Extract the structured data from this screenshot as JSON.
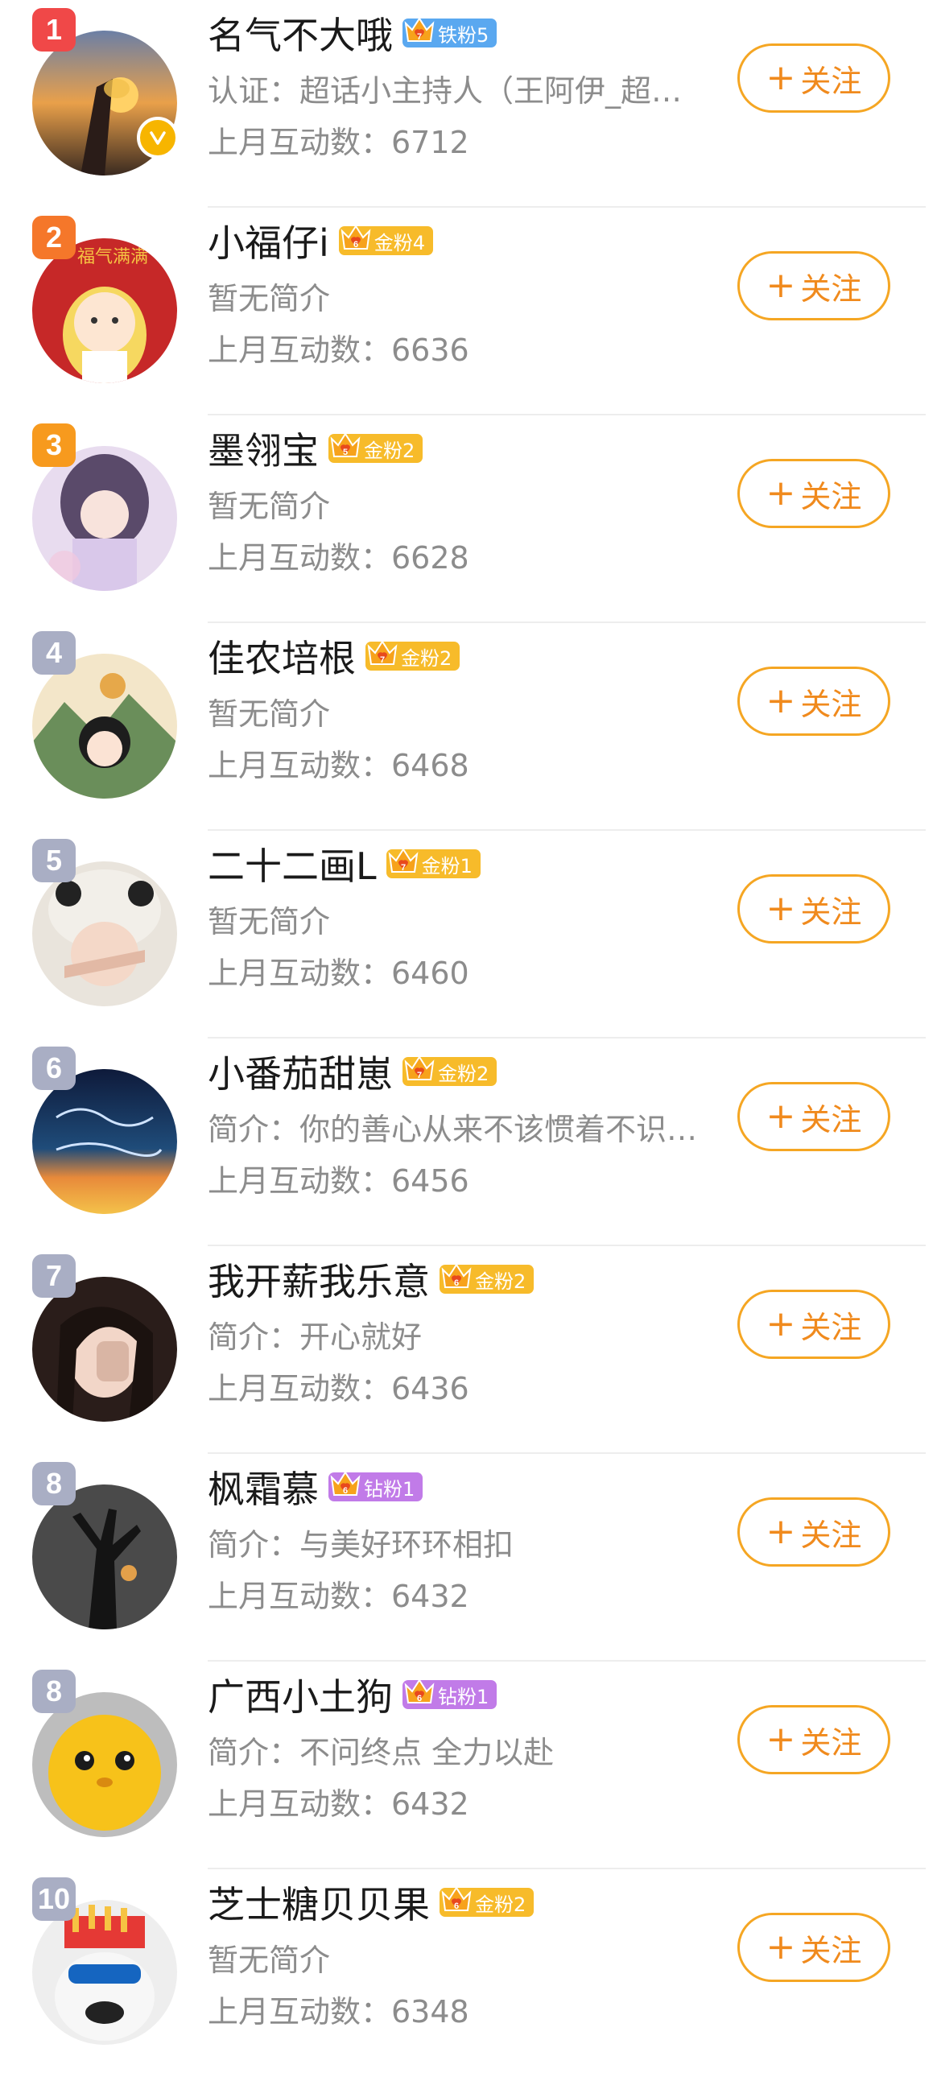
{
  "follow_label": "关注",
  "follow_plus": "+",
  "users": [
    {
      "rank": "1",
      "name": "名气不大哦",
      "badge": "铁粉5",
      "badge_level": "7",
      "badge_color": "#5aa8f0",
      "bio": "认证：超话小主持人（王阿伊_超…",
      "stat": "上月互动数：6712",
      "verified": true
    },
    {
      "rank": "2",
      "name": "小福仔i",
      "badge": "金粉4",
      "badge_level": "6",
      "badge_color": "#f7bb2a",
      "bio": "暂无简介",
      "stat": "上月互动数：6636",
      "verified": false,
      "avatar_text": "福气满满"
    },
    {
      "rank": "3",
      "name": "墨翎宝",
      "badge": "金粉2",
      "badge_level": "5",
      "badge_color": "#f7bb2a",
      "bio": "暂无简介",
      "stat": "上月互动数：6628",
      "verified": false
    },
    {
      "rank": "4",
      "name": "佳农培根",
      "badge": "金粉2",
      "badge_level": "7",
      "badge_color": "#f7bb2a",
      "bio": "暂无简介",
      "stat": "上月互动数：6468",
      "verified": false
    },
    {
      "rank": "5",
      "name": "二十二画L",
      "badge": "金粉1",
      "badge_level": "7",
      "badge_color": "#f7bb2a",
      "bio": "暂无简介",
      "stat": "上月互动数：6460",
      "verified": false
    },
    {
      "rank": "6",
      "name": "小番茄甜崽",
      "badge": "金粉2",
      "badge_level": "7",
      "badge_color": "#f7bb2a",
      "bio": "简介：你的善心从来不该惯着不识…",
      "stat": "上月互动数：6456",
      "verified": false
    },
    {
      "rank": "7",
      "name": "我开薪我乐意",
      "badge": "金粉2",
      "badge_level": "6",
      "badge_color": "#f7bb2a",
      "bio": "简介：开心就好",
      "stat": "上月互动数：6436",
      "verified": false
    },
    {
      "rank": "8",
      "name": "枫霜慕",
      "badge": "钻粉1",
      "badge_level": "6",
      "badge_color": "#c17be8",
      "bio": "简介：与美好环环相扣",
      "stat": "上月互动数：6432",
      "verified": false
    },
    {
      "rank": "8",
      "name": "广西小土狗",
      "badge": "钻粉1",
      "badge_level": "6",
      "badge_color": "#c17be8",
      "bio": "简介：不问终点 全力以赴",
      "stat": "上月互动数：6432",
      "verified": false
    },
    {
      "rank": "10",
      "name": "芝士糖贝贝果",
      "badge": "金粉2",
      "badge_level": "6",
      "badge_color": "#f7bb2a",
      "bio": "暂无简介",
      "stat": "上月互动数：6348",
      "verified": false
    }
  ],
  "rank_colors": {
    "gold": "#f04848",
    "silver": "#f5772a",
    "bronze": "#f79a1e",
    "other": "#a9aec4"
  }
}
